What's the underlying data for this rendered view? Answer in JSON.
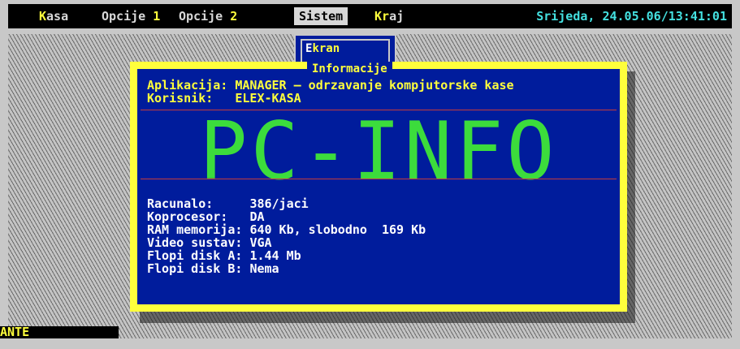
{
  "menubar": {
    "items": [
      {
        "hot": "K",
        "rest": "asa"
      },
      {
        "text": "Opcije ",
        "num": "1"
      },
      {
        "text": "Opcije ",
        "num": "2"
      },
      {
        "text": "Sistem"
      },
      {
        "hot": "Kr",
        "rest": "aj"
      }
    ],
    "datetime": "Srijeda, 24.05.06/13:41:01"
  },
  "ekran": {
    "hot": "E",
    "rest": "kran"
  },
  "dialog": {
    "title": "Informacije",
    "aplikacija_label": "Aplikacija:",
    "aplikacija_value": "MANAGER – odrzavanje kompjutorske kase",
    "korisnik_label": "Korisnik:",
    "korisnik_value": "ELEX-KASA",
    "banner": "PC-INFO",
    "info": [
      {
        "label": "Racunalo:     ",
        "value": "386/jaci"
      },
      {
        "label": "Koprocesor:   ",
        "value": "DA"
      },
      {
        "label": "RAM memorija: ",
        "value": "640 Kb, slobodno  169 Kb"
      },
      {
        "label": "Video sustav: ",
        "value": "VGA"
      },
      {
        "label": "Flopi disk A: ",
        "value": "1.44 Mb"
      },
      {
        "label": "Flopi disk B: ",
        "value": "Nema"
      }
    ]
  },
  "status": {
    "user": "ANTE"
  }
}
